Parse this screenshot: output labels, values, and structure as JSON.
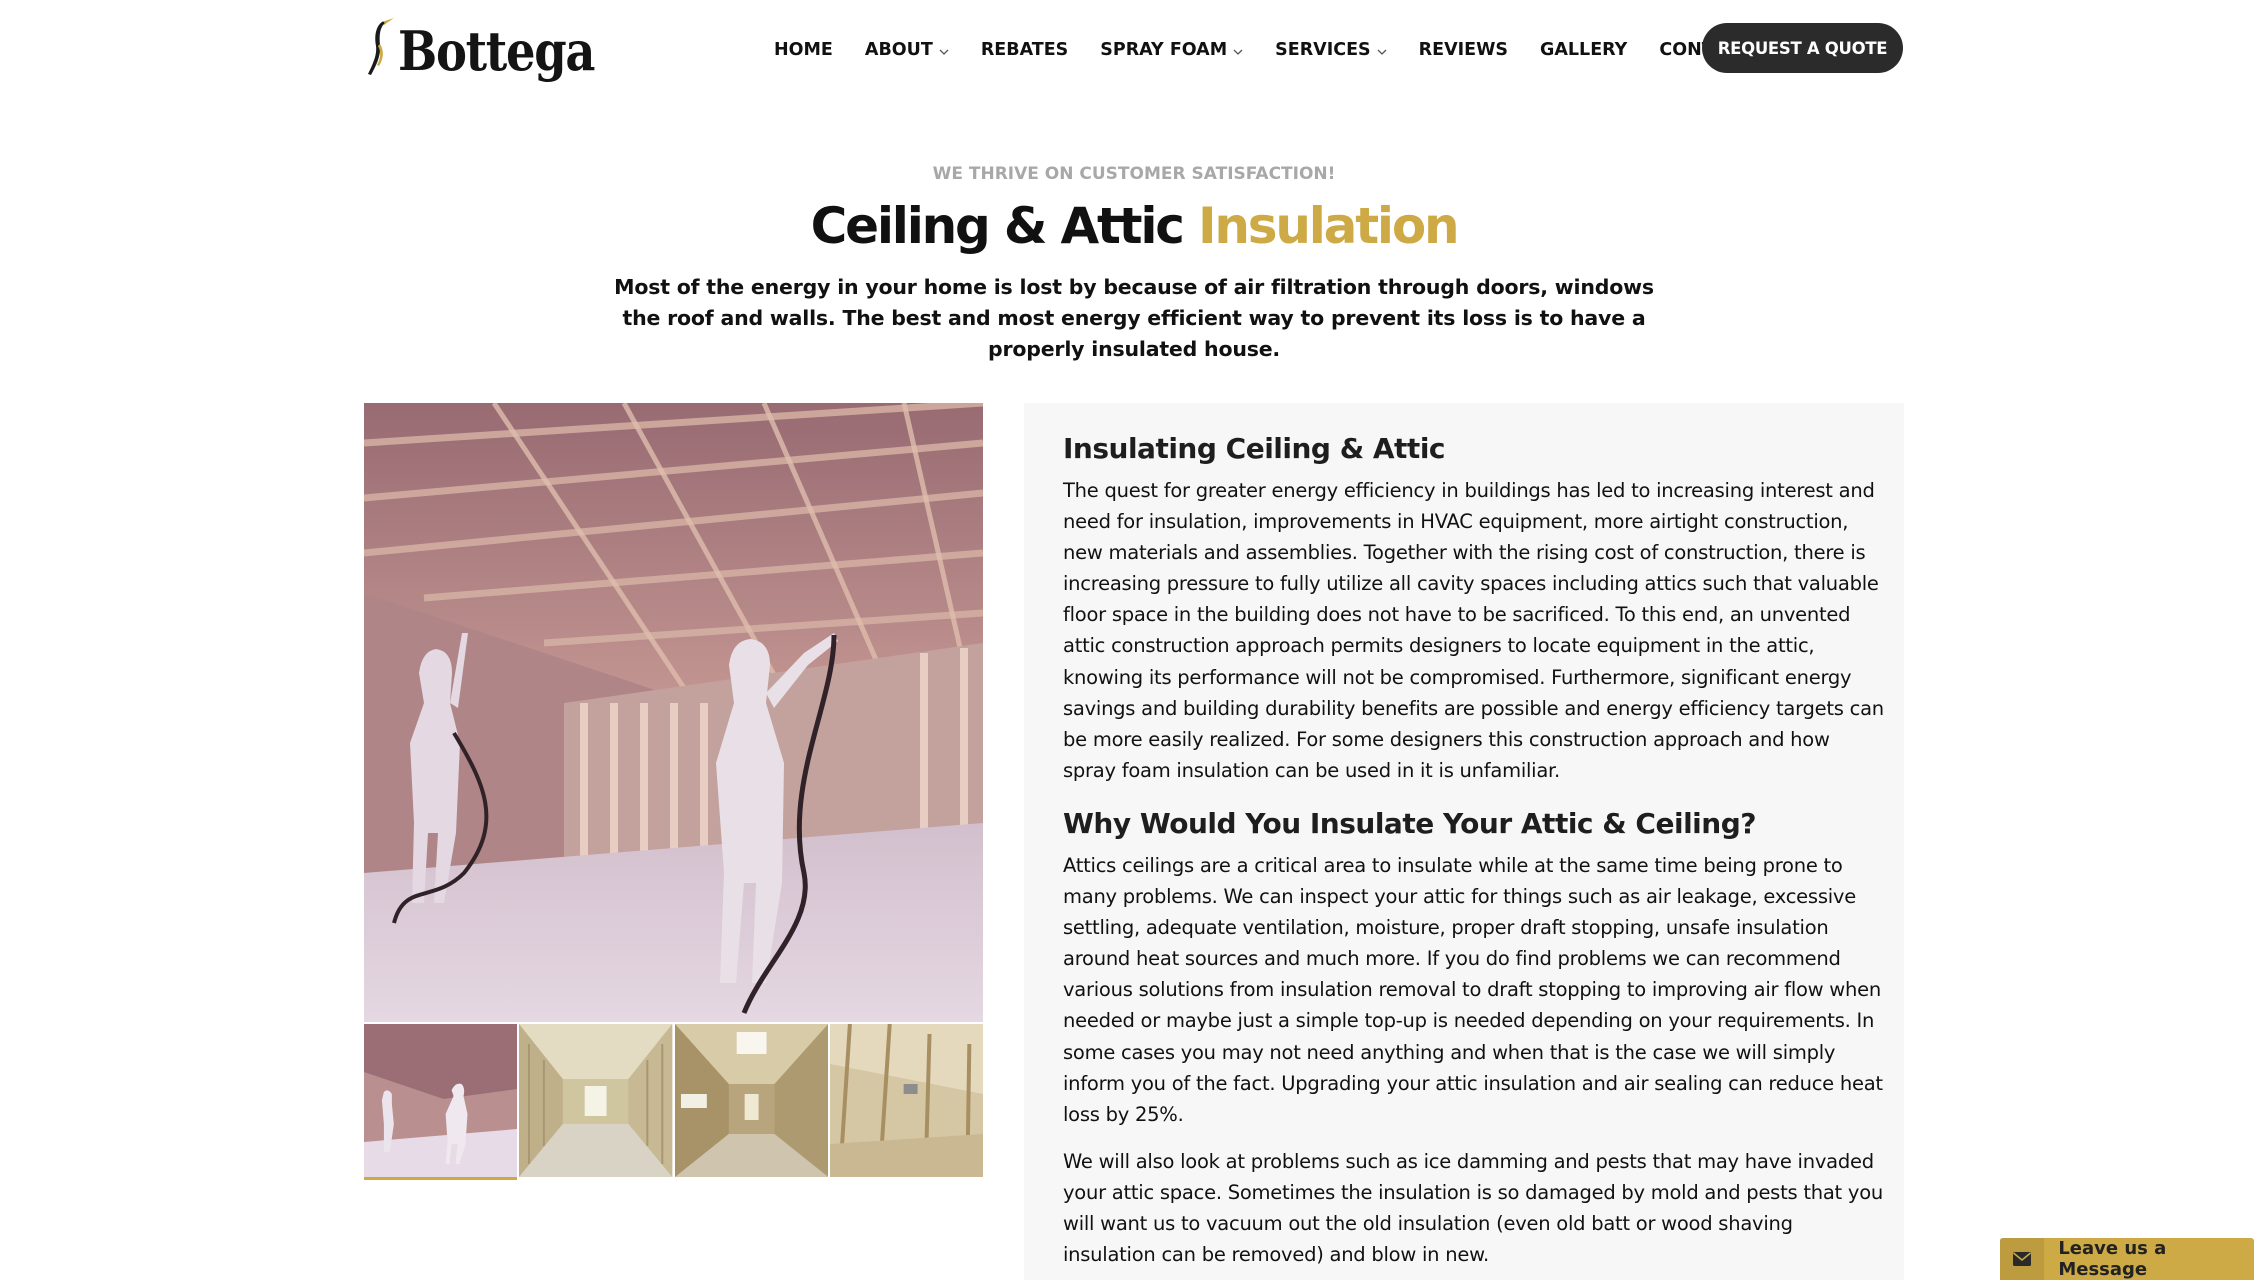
{
  "header": {
    "logo_text": "Bottega",
    "nav": [
      {
        "label": "HOME",
        "has_dropdown": false
      },
      {
        "label": "ABOUT",
        "has_dropdown": true
      },
      {
        "label": "REBATES",
        "has_dropdown": false
      },
      {
        "label": "SPRAY FOAM",
        "has_dropdown": true
      },
      {
        "label": "SERVICES",
        "has_dropdown": true
      },
      {
        "label": "REVIEWS",
        "has_dropdown": false
      },
      {
        "label": "GALLERY",
        "has_dropdown": false
      },
      {
        "label": "CONTACT",
        "has_dropdown": false
      }
    ],
    "cta_label": "REQUEST A QUOTE"
  },
  "hero": {
    "eyebrow": "WE THRIVE ON CUSTOMER SATISFACTION!",
    "title_main": "Ceiling & Attic",
    "title_accent": "Insulation",
    "subtitle": "Most of the energy in your home is lost by because of air filtration through doors, windows the roof and walls. The best and most energy efficient way to prevent its loss is to have a properly insulated house."
  },
  "gallery": {
    "active_index": 0,
    "thumb_count": 4
  },
  "content": {
    "heading1": "Insulating Ceiling & Attic",
    "paragraph1": "The quest for greater energy efficiency in buildings has led to increasing interest and need for insulation, improvements in HVAC equipment, more airtight construction, new materials and assemblies. Together with the rising cost of construction, there is increasing pressure to fully utilize all cavity spaces including attics such that valuable floor space in the building does not have to be sacrificed. To this end, an unvented attic construction approach permits designers to locate equipment in the attic, knowing its performance will not be compromised. Furthermore, significant energy savings and building durability benefits are possible and energy efficiency targets can be more easily realized. For some designers this construction approach and how spray foam insulation can be used in it is unfamiliar.",
    "heading2": "Why Would You Insulate Your Attic & Ceiling?",
    "paragraph2": "Attics ceilings are a critical area to insulate while at the same time being prone to many problems. We can inspect your attic for things such as air leakage, excessive settling, adequate ventilation, moisture, proper draft stopping, unsafe insulation around heat sources and much more. If you do find problems we can recommend various solutions from insulation removal to draft stopping to improving air flow when needed or maybe just a simple top-up is needed depending on your requirements. In some cases you may not need anything and when that is the case we will simply inform you of the fact. Upgrading your attic insulation and air sealing can reduce heat loss by 25%.",
    "paragraph3": "We will also look at problems such as ice damming and pests that may have invaded your attic space. Sometimes the insulation is so damaged by mold and pests that you will want us to vacuum out the old insulation (even old batt or wood shaving insulation can be removed) and blow in new."
  },
  "chat_widget": {
    "label": "Leave us a Message",
    "icon": "envelope-icon"
  },
  "colors": {
    "accent": "#cdaa45",
    "button_dark": "#2b2b2b",
    "eyebrow_gray": "#a8a8a8",
    "panel_bg": "#f7f7f7"
  }
}
